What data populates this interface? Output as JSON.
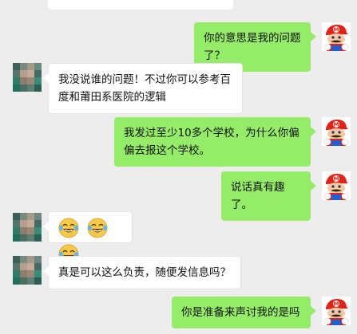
{
  "chat": {
    "messages": [
      {
        "side": "right",
        "text": "你的意思是我的问题了？"
      },
      {
        "side": "left",
        "lines": [
          "我没说谁的问题！不过你可以参考百",
          "度和莆田系医院的逻辑"
        ]
      },
      {
        "side": "right",
        "lines": [
          "我发过至少10多个学校，为什么你偏",
          "偏去报这个学校。"
        ]
      },
      {
        "side": "right",
        "text": "说话真有趣了。"
      },
      {
        "side": "left",
        "emojis": [
          "laughing-crying",
          "laughing-crying",
          "laughing-crying"
        ]
      },
      {
        "side": "left",
        "text": "真是可以这么负责，随便发信息吗？"
      },
      {
        "side": "right",
        "text": "你是准备来声讨我的是吗"
      }
    ]
  },
  "colors": {
    "background": "#ededed",
    "sent_bubble": "#95ec69",
    "received_bubble": "#ffffff"
  },
  "avatars": {
    "self": "mario-avatar",
    "other": "pixelated-avatar"
  }
}
